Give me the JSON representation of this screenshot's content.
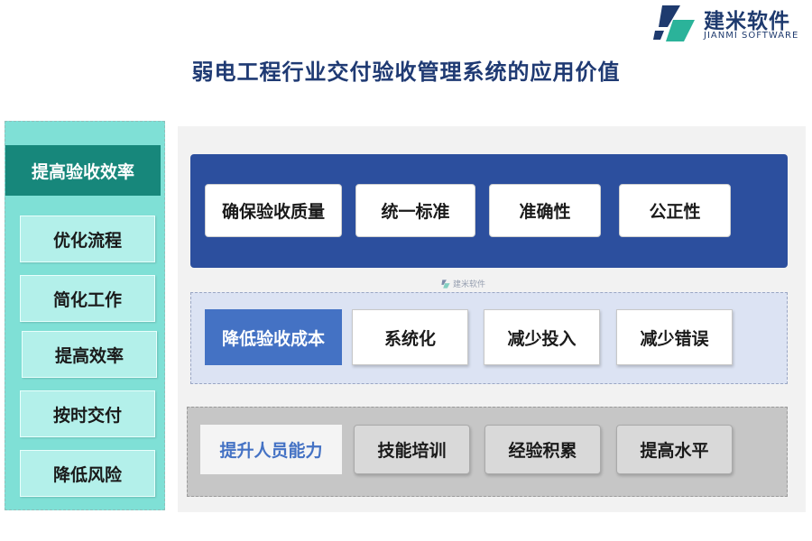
{
  "logo": {
    "name_cn": "建米软件",
    "name_en": "JIANMI SOFTWARE"
  },
  "title": "弱电工程行业交付验收管理系统的应用价值",
  "left_panel": {
    "header": "提高验收效率",
    "items": [
      "优化流程",
      "简化工作",
      "提高效率",
      "按时交付",
      "降低风险"
    ]
  },
  "row1": {
    "items": [
      "确保验收质量",
      "统一标准",
      "准确性",
      "公正性"
    ]
  },
  "row2": {
    "header": "降低验收成本",
    "items": [
      "系统化",
      "减少投入",
      "减少错误"
    ]
  },
  "row3": {
    "header": "提升人员能力",
    "items": [
      "技能培训",
      "经验积累",
      "提高水平"
    ]
  },
  "watermark": "建米软件",
  "colors": {
    "title": "#1f3a73",
    "teal_dark": "#17877b",
    "teal_light": "#7fe0d6",
    "blue_dark": "#2c4f9e",
    "blue_accent": "#4472c4"
  }
}
